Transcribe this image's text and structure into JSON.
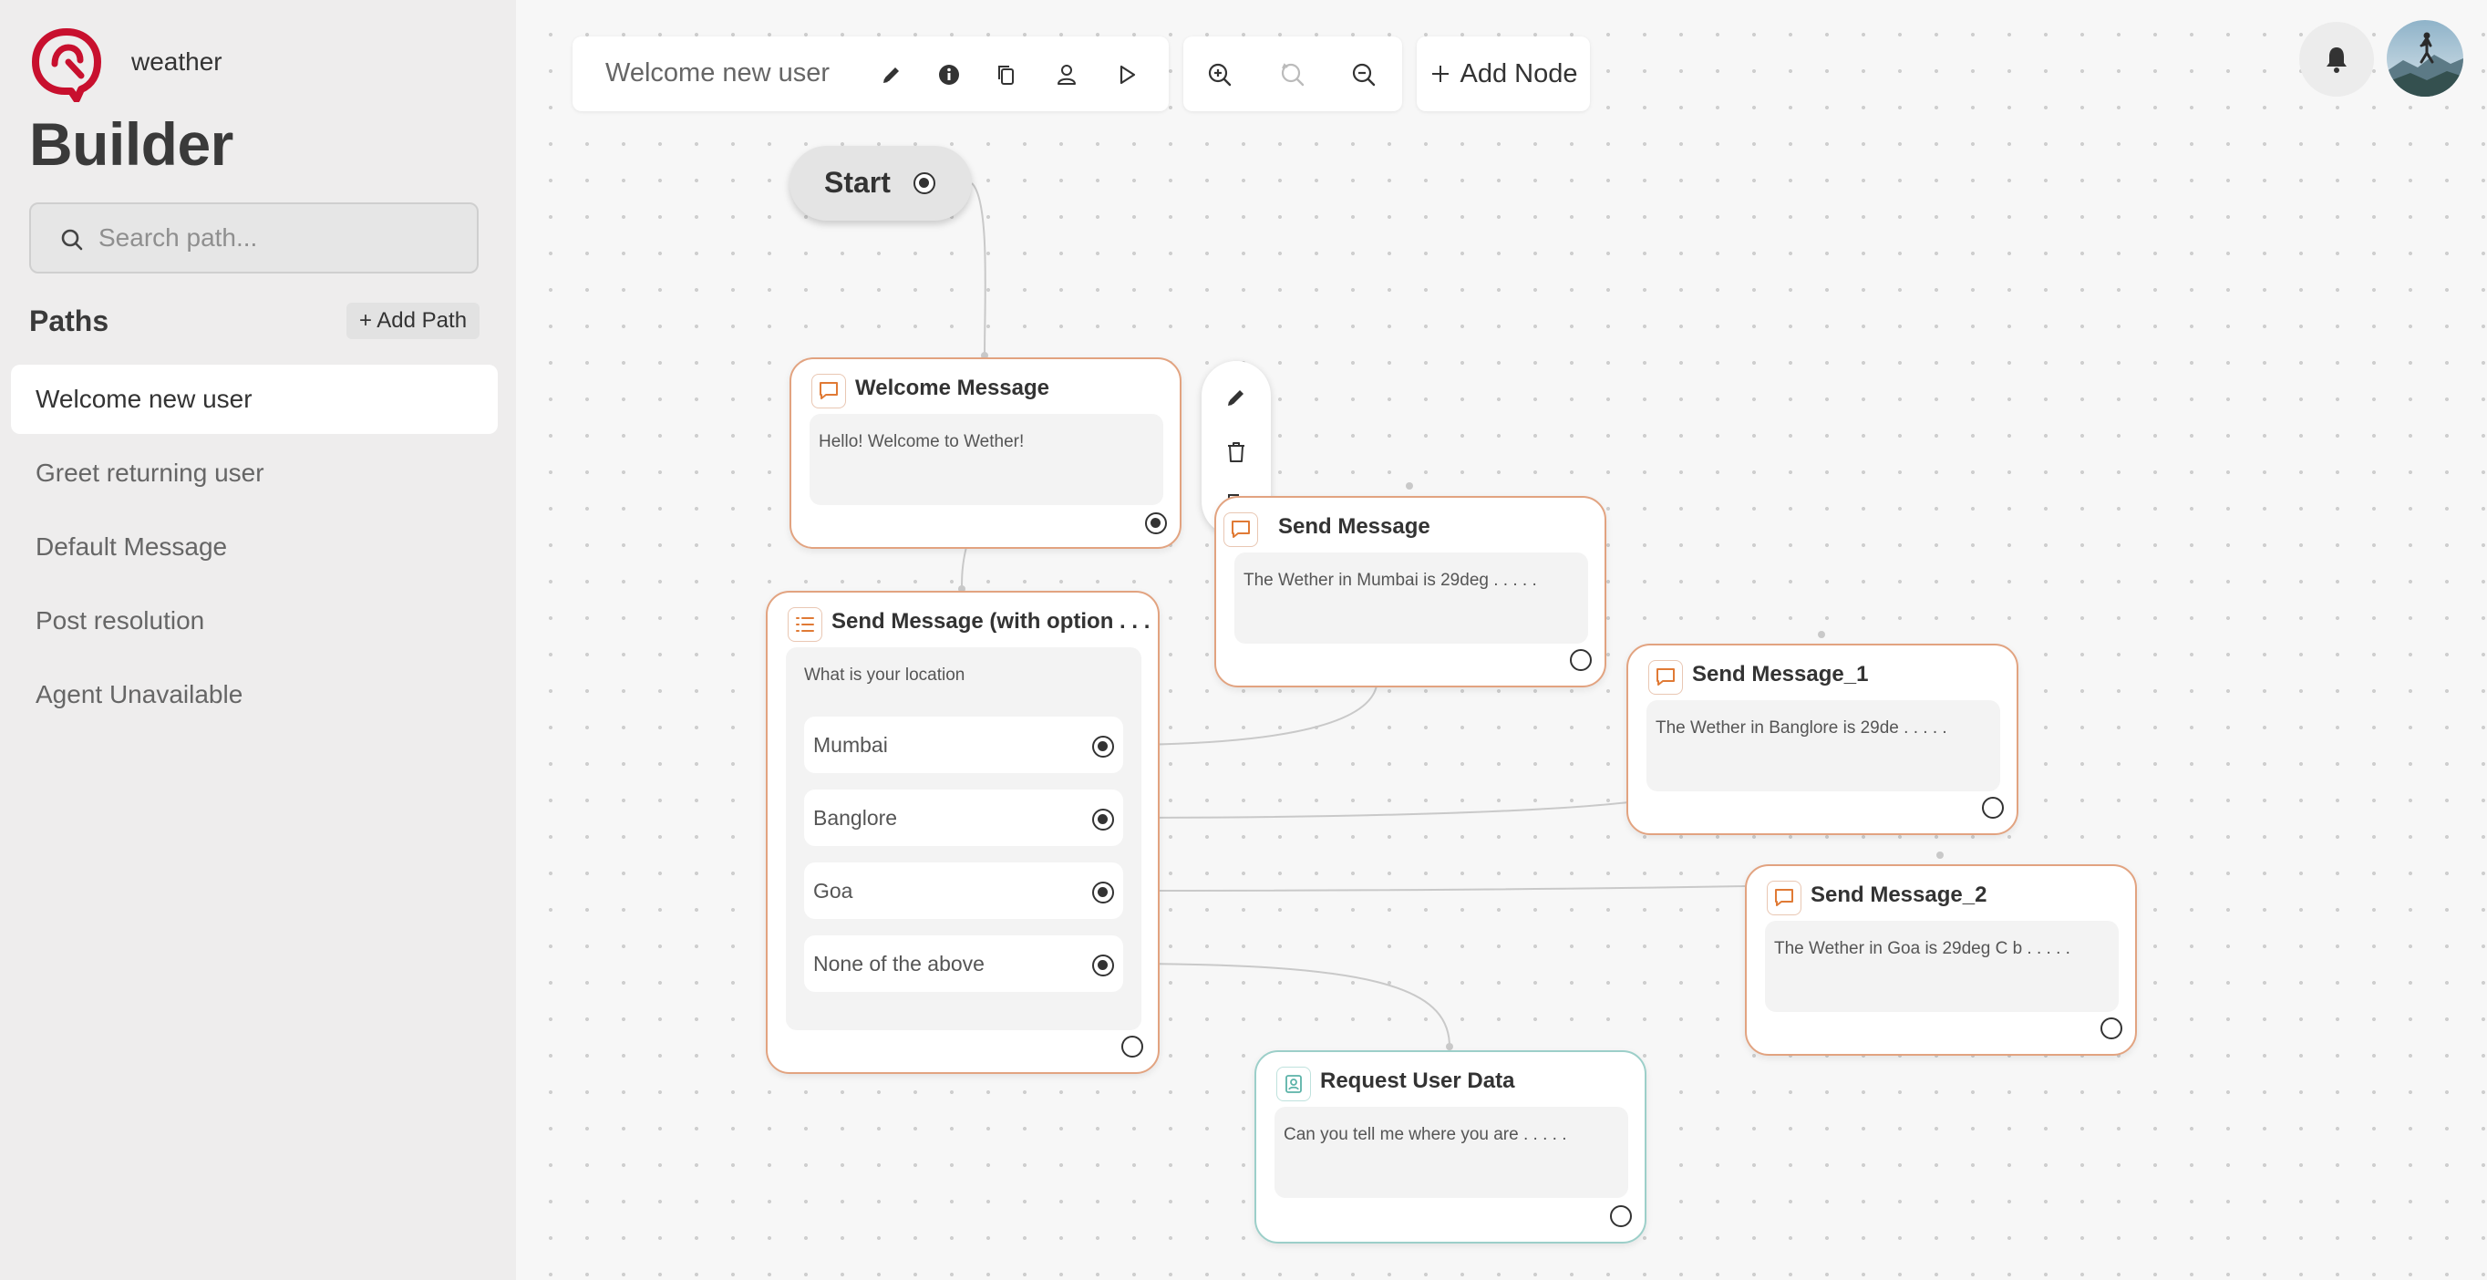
{
  "app": {
    "name": "weather",
    "section_title": "Builder"
  },
  "search": {
    "placeholder": "Search path..."
  },
  "paths": {
    "label": "Paths",
    "add_label": "+ Add Path",
    "items": [
      {
        "label": "Welcome new user",
        "active": true
      },
      {
        "label": "Greet returning user"
      },
      {
        "label": "Default Message"
      },
      {
        "label": "Post resolution"
      },
      {
        "label": "Agent Unavailable"
      }
    ]
  },
  "toolbar": {
    "path_title": "Welcome new user",
    "icons": [
      "edit-icon",
      "info-icon",
      "copy-icon",
      "user-icon",
      "play-icon"
    ],
    "zoom_icons": [
      "zoom-in-icon",
      "reset-zoom-icon",
      "zoom-out-icon"
    ],
    "add_node_label": "Add Node"
  },
  "header": {
    "icons": [
      "bell-icon",
      "avatar"
    ]
  },
  "canvas": {
    "start_label": "Start",
    "context_menu_icons": [
      "edit-icon",
      "trash-icon",
      "copy-icon"
    ],
    "nodes": {
      "welcome": {
        "title": "Welcome Message",
        "text": "Hello! Welcome to Wether!"
      },
      "send_message": {
        "title": "Send Message",
        "text": "The Wether in Mumbai is 29deg . . . . ."
      },
      "options": {
        "title": "Send Message (with option . . .",
        "question": "What is your location",
        "options": [
          "Mumbai",
          "Banglore",
          "Goa",
          "None of the above"
        ]
      },
      "send_message_1": {
        "title": "Send Message_1",
        "text": "The Wether in Banglore is 29de . . . . ."
      },
      "send_message_2": {
        "title": "Send Message_2",
        "text": "The Wether in Goa is 29deg C b . . . . ."
      },
      "request_user_data": {
        "title": "Request User Data",
        "text": "Can you tell me where you are . . . . ."
      }
    }
  },
  "colors": {
    "brand": "#c8102e",
    "node_border": "#e2a380",
    "node_icon": "#e07a35",
    "teal_border": "#9ccfc9",
    "teal_icon": "#5bb3a8"
  }
}
